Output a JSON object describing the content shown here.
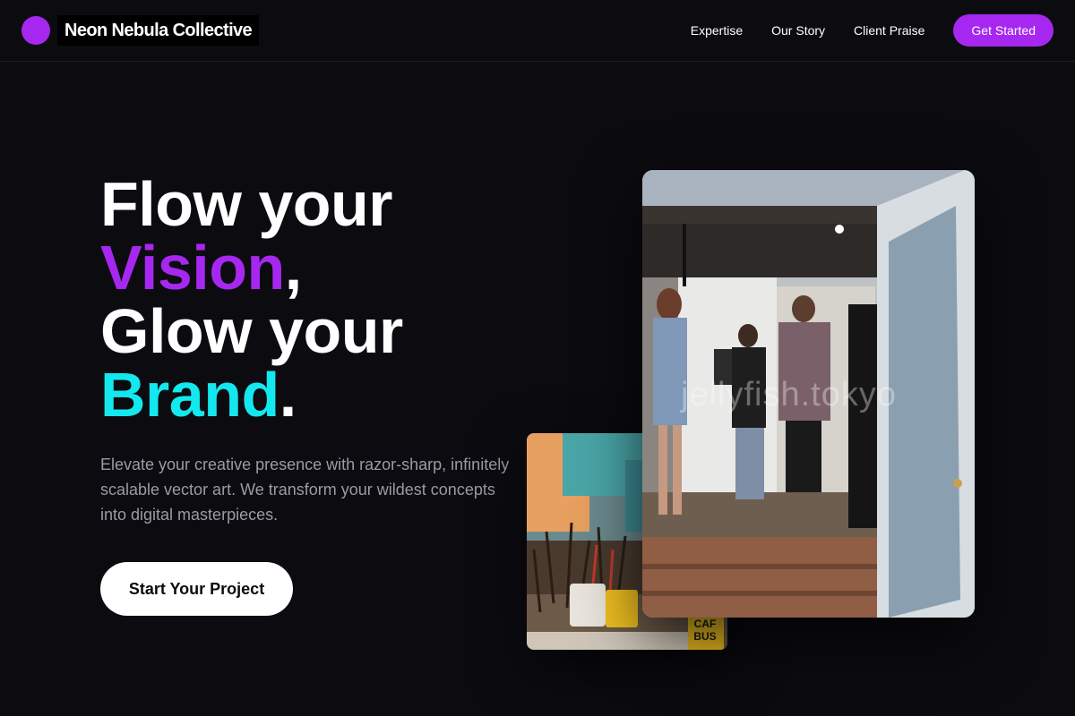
{
  "header": {
    "brand": "Neon Nebula Collective",
    "nav": [
      "Expertise",
      "Our Story",
      "Client Praise"
    ],
    "cta": "Get Started"
  },
  "hero": {
    "line1": "Flow your",
    "line2_word": "Vision",
    "line2_punct": ",",
    "line3": "Glow your",
    "line4_word": "Brand",
    "line4_punct": ".",
    "subtext": "Elevate your creative presence with razor-sharp, infinitely scalable vector art. We transform your wildest concepts into digital masterpieces.",
    "cta": "Start Your Project"
  },
  "images": {
    "large_watermark": "jellyfish.tokyo",
    "small_label_1": "CAF",
    "small_label_2": "BUS"
  },
  "colors": {
    "accent_purple": "#a628f0",
    "accent_cyan": "#13e8ee",
    "background": "#0c0b10"
  }
}
